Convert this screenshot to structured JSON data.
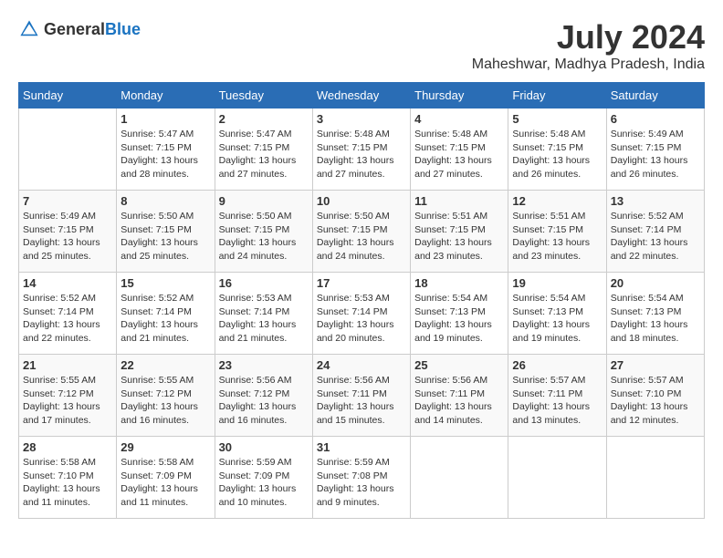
{
  "header": {
    "logo_general": "General",
    "logo_blue": "Blue",
    "month_year": "July 2024",
    "location": "Maheshwar, Madhya Pradesh, India"
  },
  "weekdays": [
    "Sunday",
    "Monday",
    "Tuesday",
    "Wednesday",
    "Thursday",
    "Friday",
    "Saturday"
  ],
  "weeks": [
    [
      {
        "day": "",
        "info": ""
      },
      {
        "day": "1",
        "info": "Sunrise: 5:47 AM\nSunset: 7:15 PM\nDaylight: 13 hours\nand 28 minutes."
      },
      {
        "day": "2",
        "info": "Sunrise: 5:47 AM\nSunset: 7:15 PM\nDaylight: 13 hours\nand 27 minutes."
      },
      {
        "day": "3",
        "info": "Sunrise: 5:48 AM\nSunset: 7:15 PM\nDaylight: 13 hours\nand 27 minutes."
      },
      {
        "day": "4",
        "info": "Sunrise: 5:48 AM\nSunset: 7:15 PM\nDaylight: 13 hours\nand 27 minutes."
      },
      {
        "day": "5",
        "info": "Sunrise: 5:48 AM\nSunset: 7:15 PM\nDaylight: 13 hours\nand 26 minutes."
      },
      {
        "day": "6",
        "info": "Sunrise: 5:49 AM\nSunset: 7:15 PM\nDaylight: 13 hours\nand 26 minutes."
      }
    ],
    [
      {
        "day": "7",
        "info": "Sunrise: 5:49 AM\nSunset: 7:15 PM\nDaylight: 13 hours\nand 25 minutes."
      },
      {
        "day": "8",
        "info": "Sunrise: 5:50 AM\nSunset: 7:15 PM\nDaylight: 13 hours\nand 25 minutes."
      },
      {
        "day": "9",
        "info": "Sunrise: 5:50 AM\nSunset: 7:15 PM\nDaylight: 13 hours\nand 24 minutes."
      },
      {
        "day": "10",
        "info": "Sunrise: 5:50 AM\nSunset: 7:15 PM\nDaylight: 13 hours\nand 24 minutes."
      },
      {
        "day": "11",
        "info": "Sunrise: 5:51 AM\nSunset: 7:15 PM\nDaylight: 13 hours\nand 23 minutes."
      },
      {
        "day": "12",
        "info": "Sunrise: 5:51 AM\nSunset: 7:15 PM\nDaylight: 13 hours\nand 23 minutes."
      },
      {
        "day": "13",
        "info": "Sunrise: 5:52 AM\nSunset: 7:14 PM\nDaylight: 13 hours\nand 22 minutes."
      }
    ],
    [
      {
        "day": "14",
        "info": "Sunrise: 5:52 AM\nSunset: 7:14 PM\nDaylight: 13 hours\nand 22 minutes."
      },
      {
        "day": "15",
        "info": "Sunrise: 5:52 AM\nSunset: 7:14 PM\nDaylight: 13 hours\nand 21 minutes."
      },
      {
        "day": "16",
        "info": "Sunrise: 5:53 AM\nSunset: 7:14 PM\nDaylight: 13 hours\nand 21 minutes."
      },
      {
        "day": "17",
        "info": "Sunrise: 5:53 AM\nSunset: 7:14 PM\nDaylight: 13 hours\nand 20 minutes."
      },
      {
        "day": "18",
        "info": "Sunrise: 5:54 AM\nSunset: 7:13 PM\nDaylight: 13 hours\nand 19 minutes."
      },
      {
        "day": "19",
        "info": "Sunrise: 5:54 AM\nSunset: 7:13 PM\nDaylight: 13 hours\nand 19 minutes."
      },
      {
        "day": "20",
        "info": "Sunrise: 5:54 AM\nSunset: 7:13 PM\nDaylight: 13 hours\nand 18 minutes."
      }
    ],
    [
      {
        "day": "21",
        "info": "Sunrise: 5:55 AM\nSunset: 7:12 PM\nDaylight: 13 hours\nand 17 minutes."
      },
      {
        "day": "22",
        "info": "Sunrise: 5:55 AM\nSunset: 7:12 PM\nDaylight: 13 hours\nand 16 minutes."
      },
      {
        "day": "23",
        "info": "Sunrise: 5:56 AM\nSunset: 7:12 PM\nDaylight: 13 hours\nand 16 minutes."
      },
      {
        "day": "24",
        "info": "Sunrise: 5:56 AM\nSunset: 7:11 PM\nDaylight: 13 hours\nand 15 minutes."
      },
      {
        "day": "25",
        "info": "Sunrise: 5:56 AM\nSunset: 7:11 PM\nDaylight: 13 hours\nand 14 minutes."
      },
      {
        "day": "26",
        "info": "Sunrise: 5:57 AM\nSunset: 7:11 PM\nDaylight: 13 hours\nand 13 minutes."
      },
      {
        "day": "27",
        "info": "Sunrise: 5:57 AM\nSunset: 7:10 PM\nDaylight: 13 hours\nand 12 minutes."
      }
    ],
    [
      {
        "day": "28",
        "info": "Sunrise: 5:58 AM\nSunset: 7:10 PM\nDaylight: 13 hours\nand 11 minutes."
      },
      {
        "day": "29",
        "info": "Sunrise: 5:58 AM\nSunset: 7:09 PM\nDaylight: 13 hours\nand 11 minutes."
      },
      {
        "day": "30",
        "info": "Sunrise: 5:59 AM\nSunset: 7:09 PM\nDaylight: 13 hours\nand 10 minutes."
      },
      {
        "day": "31",
        "info": "Sunrise: 5:59 AM\nSunset: 7:08 PM\nDaylight: 13 hours\nand 9 minutes."
      },
      {
        "day": "",
        "info": ""
      },
      {
        "day": "",
        "info": ""
      },
      {
        "day": "",
        "info": ""
      }
    ]
  ]
}
